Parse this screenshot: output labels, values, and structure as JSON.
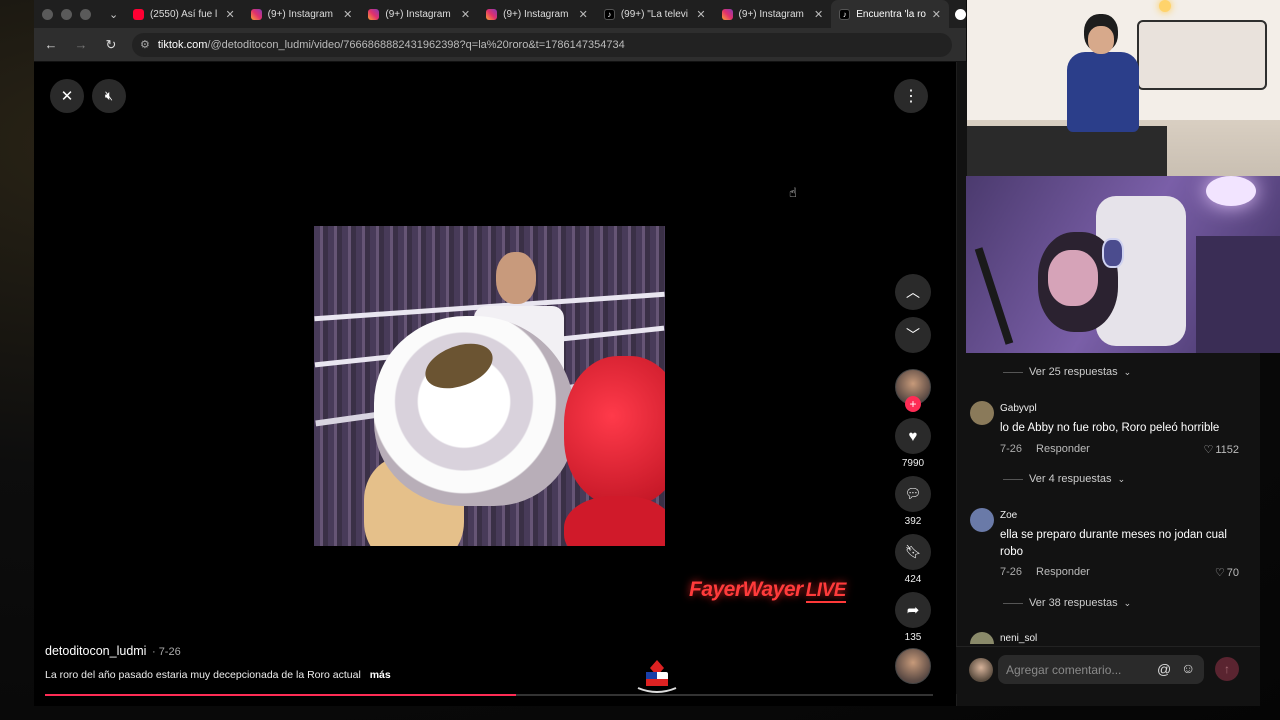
{
  "browser": {
    "tabs": [
      {
        "label": "(2550) Así fue l",
        "favicon": "youtube-icon"
      },
      {
        "label": "(9+) Instagram",
        "favicon": "instagram-icon"
      },
      {
        "label": "(9+) Instagram",
        "favicon": "instagram-icon"
      },
      {
        "label": "(9+) Instagram",
        "favicon": "instagram-icon"
      },
      {
        "label": "(99+) \"La televi",
        "favicon": "tiktok-icon"
      },
      {
        "label": "(9+) Instagram",
        "favicon": "instagram-icon"
      },
      {
        "label": "Encuentra 'la ro",
        "favicon": "tiktok-icon",
        "active": true
      }
    ],
    "url_host": "tiktok.com",
    "url_path": "/@detoditocon_ludmi/video/7666868882431962398?q=la%20roro&t=1786147354734"
  },
  "video": {
    "author": "detoditocon_ludmi",
    "date": "7-26",
    "caption": "La roro del año pasado estaria muy decepcionada de la Roro actual",
    "more_label": "más",
    "progress": 0.53,
    "overlay_brand": "FayerWayer",
    "overlay_live": "LIVE"
  },
  "actions": {
    "likes": "7990",
    "comments": "392",
    "saves": "424",
    "shares": "135"
  },
  "comments": {
    "items": [
      {
        "replies_label": "Ver 25 respuestas"
      },
      {
        "user": "Gabyvpl",
        "text": "lo de Abby no fue robo, Roro peleó horrible",
        "date": "7-26",
        "reply_label": "Responder",
        "likes": "1152",
        "replies_label": "Ver 4 respuestas",
        "avatar_color": "#8a7a5a"
      },
      {
        "user": "Zoe",
        "text": "ella se preparo durante meses no jodan cual robo",
        "date": "7-26",
        "reply_label": "Responder",
        "likes": "70",
        "replies_label": "Ver 38 respuestas",
        "avatar_color": "#6a7aa8"
      },
      {
        "user": "neni_sol"
      }
    ],
    "input_placeholder": "Agregar comentario..."
  },
  "colors": {
    "accent": "#fe2c55",
    "brand_overlay": "#ff3b3b"
  }
}
